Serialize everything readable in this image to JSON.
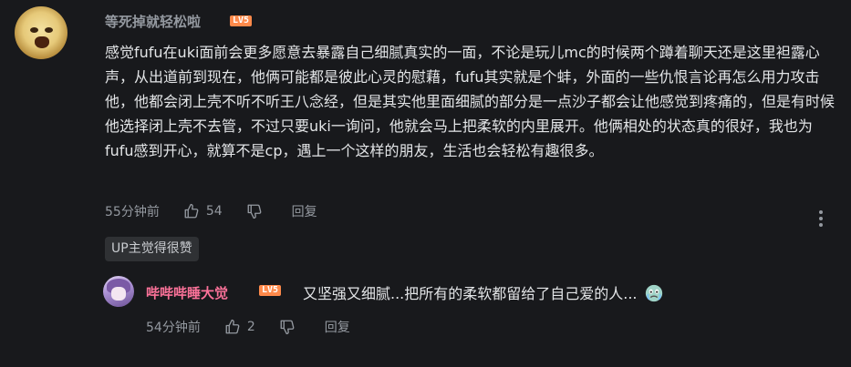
{
  "comment": {
    "username": "等死掉就轻松啦",
    "level": "LV5",
    "content": "感觉fufu在uki面前会更多愿意去暴露自己细腻真实的一面，不论是玩儿mc的时候两个蹲着聊天还是这里袒露心声，从出道前到现在，他俩可能都是彼此心灵的慰藉，fufu其实就是个蚌，外面的一些仇恨言论再怎么用力攻击他，他都会闭上壳不听不听王八念经，但是其实他里面细腻的部分是一点沙子都会让他感觉到疼痛的，但是有时候他选择闭上壳不去管，不过只要uki一询问，他就会马上把柔软的内里展开。他俩相处的状态真的很好，我也为fufu感到开心，就算不是cp，遇上一个这样的朋友，生活也会轻松有趣很多。",
    "time": "55分钟前",
    "likes": "54",
    "reply_label": "回复",
    "up_tag": "UP主觉得很赞",
    "icons": {
      "like": "thumb-up-icon",
      "dislike": "thumb-down-icon",
      "more": "more-vertical-icon"
    }
  },
  "reply": {
    "username": "哔哔哔睡大觉",
    "level": "LV5",
    "text": "又坚强又细腻...把所有的柔软都留给了自己爱的人...",
    "emoji": "crying-emoji-icon",
    "time": "54分钟前",
    "likes": "2",
    "reply_label": "回复"
  },
  "colors": {
    "background": "#18191c",
    "text": "#e3e5e7",
    "muted": "#9499a0",
    "level_badge": "#ff8a4b",
    "reply_username": "#fb7299",
    "tag_background": "#2f3134"
  }
}
